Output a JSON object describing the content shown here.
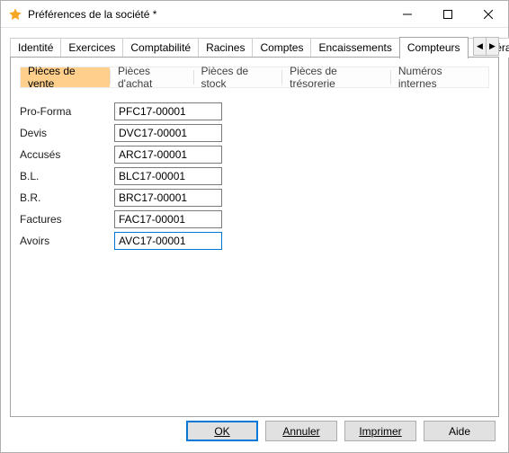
{
  "window": {
    "title": "Préférences de la société *"
  },
  "tabs": {
    "items": [
      "Identité",
      "Exercices",
      "Comptabilité",
      "Racines",
      "Comptes",
      "Encaissements",
      "Compteurs",
      "Général"
    ],
    "active_index": 6
  },
  "subtabs": {
    "items": [
      "Pièces de vente",
      "Pièces d'achat",
      "Pièces de stock",
      "Pièces de trésorerie",
      "Numéros internes"
    ],
    "active_index": 0
  },
  "form": {
    "rows": [
      {
        "label": "Pro-Forma",
        "value": "PFC17-00001"
      },
      {
        "label": "Devis",
        "value": "DVC17-00001"
      },
      {
        "label": "Accusés",
        "value": "ARC17-00001"
      },
      {
        "label": "B.L.",
        "value": "BLC17-00001"
      },
      {
        "label": "B.R.",
        "value": "BRC17-00001"
      },
      {
        "label": "Factures",
        "value": "FAC17-00001"
      },
      {
        "label": "Avoirs",
        "value": "AVC17-00001"
      }
    ],
    "focused_index": 6
  },
  "buttons": {
    "ok": "OK",
    "cancel": "Annuler",
    "print": "Imprimer",
    "help": "Aide"
  }
}
